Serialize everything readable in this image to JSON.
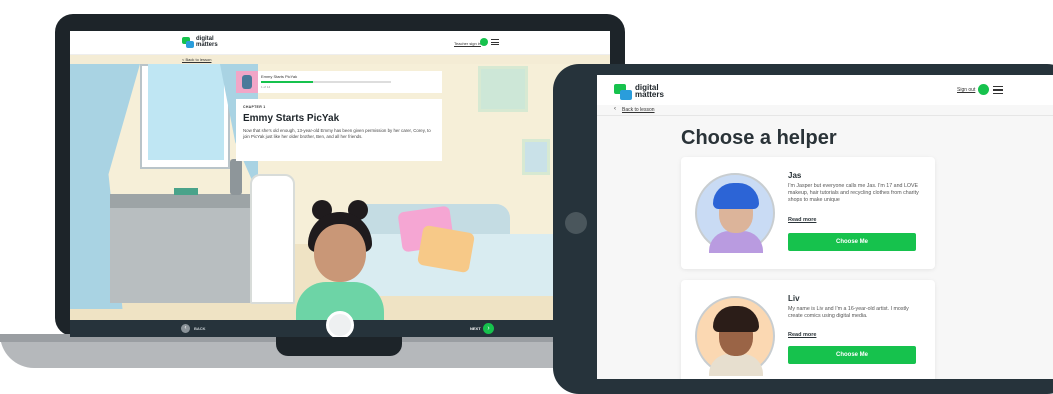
{
  "laptop": {
    "header": {
      "logo_line1": "digital",
      "logo_line2": "matters",
      "teacher_link": "Teacher sign in"
    },
    "back_link": "< Back to lesson",
    "chapter_bar": {
      "title": "Emmy Starts PicYak",
      "count": "1 of 14",
      "progress": 0.4
    },
    "chapter_card": {
      "label": "CHAPTER 1",
      "heading": "Emmy Starts PicYak",
      "description": "Now that she's old enough, 13-year-old Emmy has been given permission by her carer, Corey, to join PicYak just like her older brother, Ben, and all her friends."
    },
    "footer": {
      "back_label": "BACK",
      "next_label": "NEXT",
      "back_icon": "‹",
      "next_icon": "›"
    }
  },
  "tablet": {
    "header": {
      "logo_line1": "digital",
      "logo_line2": "matters",
      "signout_link": "Sign out"
    },
    "back_arrow": "‹",
    "back_link": "Back to lesson",
    "title": "Choose a helper",
    "helpers": [
      {
        "name": "Jas",
        "description": "I'm Jasper but everyone calls me Jas. I'm 17 and LOVE makeup, hair tutorials and recycling clothes from charity shops to make unique",
        "read_more": "Read more",
        "button": "Choose Me"
      },
      {
        "name": "Liv",
        "description": "My name is Liv and I'm a 16-year-old artist. I mostly create comics using digital media.",
        "read_more": "Read more",
        "button": "Choose Me"
      }
    ]
  },
  "colors": {
    "brand_green": "#16c24d",
    "brand_blue": "#2a9ddb",
    "device_dark": "#1d2429"
  }
}
